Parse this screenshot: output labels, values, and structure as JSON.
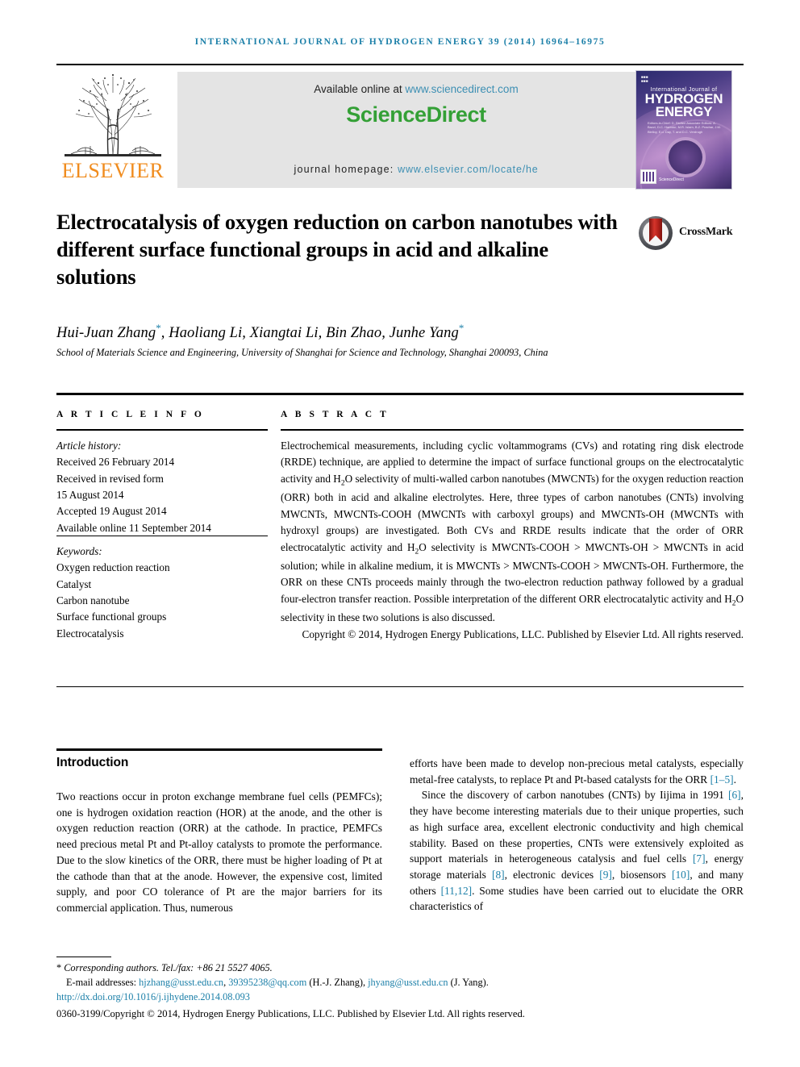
{
  "running_head": "International Journal of Hydrogen Energy 39 (2014) 16964–16975",
  "masthead": {
    "publisher_name": "ELSEVIER",
    "available_prefix": "Available online at ",
    "available_link": "www.sciencedirect.com",
    "brand": "ScienceDirect",
    "homepage_prefix": "journal homepage: ",
    "homepage_link": "www.elsevier.com/locate/he",
    "cover": {
      "small_top": "International Journal of",
      "line1": "HYDROGEN",
      "line2": "ENERGY",
      "editors": "Editors-in-Chief: D. Stolten\nAssociate Editors: A. Bazzi, D.C. Harbour, M.R. Islam, B.Z. Prachar, J.M. Bielloy, E.u. Day, T. and D.C. Verdrugh",
      "footer_brand": "ScienceDirect"
    }
  },
  "article": {
    "title": "Electrocatalysis of oxygen reduction on carbon nanotubes with different surface functional groups in acid and alkaline solutions",
    "crossmark_label": "CrossMark",
    "authors": "Hui-Juan Zhang*, Haoliang Li, Xiangtai Li, Bin Zhao, Junhe Yang*",
    "affiliation": "School of Materials Science and Engineering, University of Shanghai for Science and Technology, Shanghai 200093, China"
  },
  "article_info": {
    "heading": "A R T I C L E   I N F O",
    "history_label": "Article history:",
    "history": [
      "Received 26 February 2014",
      "Received in revised form",
      "15 August 2014",
      "Accepted 19 August 2014",
      "Available online 11 September 2014"
    ],
    "keywords_label": "Keywords:",
    "keywords": [
      "Oxygen reduction reaction",
      "Catalyst",
      "Carbon nanotube",
      "Surface functional groups",
      "Electrocatalysis"
    ]
  },
  "abstract": {
    "heading": "A B S T R A C T",
    "body_part_1": "Electrochemical measurements, including cyclic voltammograms (CVs) and rotating ring disk electrode (RRDE) technique, are applied to determine the impact of surface functional groups on the electrocatalytic activity and H",
    "body_part_2": "O selectivity of multi-walled carbon nanotubes (MWCNTs) for the oxygen reduction reaction (ORR) both in acid and alkaline electrolytes. Here, three types of carbon nanotubes (CNTs) involving MWCNTs, MWCNTs-COOH (MWCNTs with carboxyl groups) and MWCNTs-OH (MWCNTs with hydroxyl groups) are investigated. Both CVs and RRDE results indicate that the order of ORR electrocatalytic activity and H",
    "body_part_3": "O selectivity is MWCNTs-COOH > MWCNTs-OH > MWCNTs in acid solution; while in alkaline medium, it is MWCNTs > MWCNTs-COOH > MWCNTs-OH. Furthermore, the ORR on these CNTs proceeds mainly through the two-electron reduction pathway followed by a gradual four-electron transfer reaction. Possible interpretation of the different ORR electrocatalytic activity and H",
    "body_part_4": "O selectivity in these two solutions is also discussed.",
    "subscript": "2",
    "copyright": "Copyright © 2014, Hydrogen Energy Publications, LLC. Published by Elsevier Ltd. All rights reserved."
  },
  "body": {
    "section_title": "Introduction",
    "left_paragraph": "Two reactions occur in proton exchange membrane fuel cells (PEMFCs); one is hydrogen oxidation reaction (HOR) at the anode, and the other is oxygen reduction reaction (ORR) at the cathode. In practice, PEMFCs need precious metal Pt and Pt-alloy catalysts to promote the performance. Due to the slow kinetics of the ORR, there must be higher loading of Pt at the cathode than that at the anode. However, the expensive cost, limited supply, and poor CO tolerance of Pt are the major barriers for its commercial application. Thus, numerous",
    "right_paragraph_1a": "efforts have been made to develop non-precious metal catalysts, especially metal-free catalysts, to replace Pt and Pt-based catalysts for the ORR ",
    "right_ref_1": "[1–5]",
    "right_paragraph_1b": ".",
    "right_paragraph_2a": "Since the discovery of carbon nanotubes (CNTs) by Iijima in 1991 ",
    "right_ref_2": "[6]",
    "right_paragraph_2b": ", they have become interesting materials due to their unique properties, such as high surface area, excellent electronic conductivity and high chemical stability. Based on these properties, CNTs were extensively exploited as support materials in heterogeneous catalysis and fuel cells ",
    "right_ref_3": "[7]",
    "right_paragraph_2c": ", energy storage materials ",
    "right_ref_4": "[8]",
    "right_paragraph_2d": ", electronic devices ",
    "right_ref_5": "[9]",
    "right_paragraph_2e": ", biosensors ",
    "right_ref_6": "[10]",
    "right_paragraph_2f": ", and many others ",
    "right_ref_7": "[11,12]",
    "right_paragraph_2g": ". Some studies have been carried out to elucidate the ORR characteristics of"
  },
  "footnotes": {
    "corresponding": "Corresponding authors. Tel./fax: +86 21 5527 4065.",
    "email_label": "E-mail addresses: ",
    "email_1": "hjzhang@usst.edu.cn",
    "email_sep_1": ", ",
    "email_2": "39395238@qq.com",
    "email_name_1": " (H.-J. Zhang), ",
    "email_3": "jhyang@usst.edu.cn",
    "email_name_2": " (J. Yang).",
    "doi": "http://dx.doi.org/10.1016/j.ijhydene.2014.08.093",
    "issn_line": "0360-3199/Copyright © 2014, Hydrogen Energy Publications, LLC. Published by Elsevier Ltd. All rights reserved."
  },
  "colors": {
    "link": "#1b7fa8",
    "sciencedirect_green": "#34a036",
    "elsevier_orange": "#F08C1E",
    "crossmark_red": "#d6342b"
  }
}
